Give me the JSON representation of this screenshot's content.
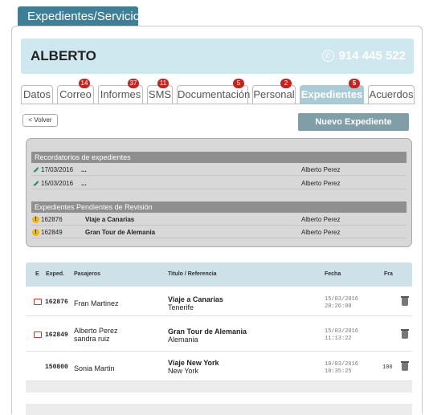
{
  "top_tab": {
    "label": "Expedientes/Servicios"
  },
  "client": {
    "name": "ALBERTO",
    "phone": "914 445 522",
    "phone_icon": "phone-icon"
  },
  "tabs": [
    {
      "label": "Datos",
      "badge": ""
    },
    {
      "label": "Correo",
      "badge": "14"
    },
    {
      "label": "Informes",
      "badge": "37"
    },
    {
      "label": "SMS",
      "badge": "11"
    },
    {
      "label": "Documentación",
      "badge": "5"
    },
    {
      "label": "Personal",
      "badge": "2"
    },
    {
      "label": "Expedientes",
      "badge": "5",
      "active": true
    },
    {
      "label": "Acuerdos",
      "badge": ""
    }
  ],
  "buttons": {
    "back": "< Volver",
    "new": "Nuevo Expediente"
  },
  "reminders": {
    "title": "Recordatorios de expedientes",
    "rows": [
      {
        "date": "17/03/2016",
        "text": "...",
        "user": "Alberto Perez"
      },
      {
        "date": "15/03/2016",
        "text": "...",
        "user": "Alberto Perez"
      }
    ]
  },
  "pending": {
    "title": "Expedientes Pendientes de Revisión",
    "rows": [
      {
        "id": "162876",
        "title": "Viaje a Canarias",
        "user": "Alberto Perez"
      },
      {
        "id": "162849",
        "title": "Gran Tour de Alemania",
        "user": "Alberto Perez"
      }
    ]
  },
  "table": {
    "headers": {
      "e": "E",
      "exped": "Exped.",
      "pasajeros": "Pasajeros",
      "titulo": "Titulo / Referencia",
      "fecha": "Fecha",
      "fra": "Fra"
    },
    "rows": [
      {
        "exped": "162876",
        "pasajeros": [
          "Fran Martinez"
        ],
        "titulo": "Viaje a Canarias",
        "referencia": "Tenerife",
        "fecha": "15/03/2016",
        "hora": "20:26:08",
        "fra": "",
        "folder": true
      },
      {
        "exped": "162849",
        "pasajeros": [
          "Alberto Perez",
          "sandra ruiz"
        ],
        "titulo": "Gran Tour de Alemania",
        "referencia": "Alemania",
        "fecha": "15/03/2016",
        "hora": "11:13:22",
        "fra": "",
        "folder": true
      },
      {
        "exped": "150800",
        "pasajeros": [
          "Sonia Martin"
        ],
        "titulo": "Viaje New York",
        "referencia": "New York",
        "fecha": "10/03/2016",
        "hora": "10:35:25",
        "fra": "100",
        "folder": false
      }
    ]
  },
  "colors": {
    "accent": "#3f7f96",
    "header_bg": "#cfe7ee",
    "badge": "#c9211e",
    "active_tab": "#a8cbd7"
  }
}
